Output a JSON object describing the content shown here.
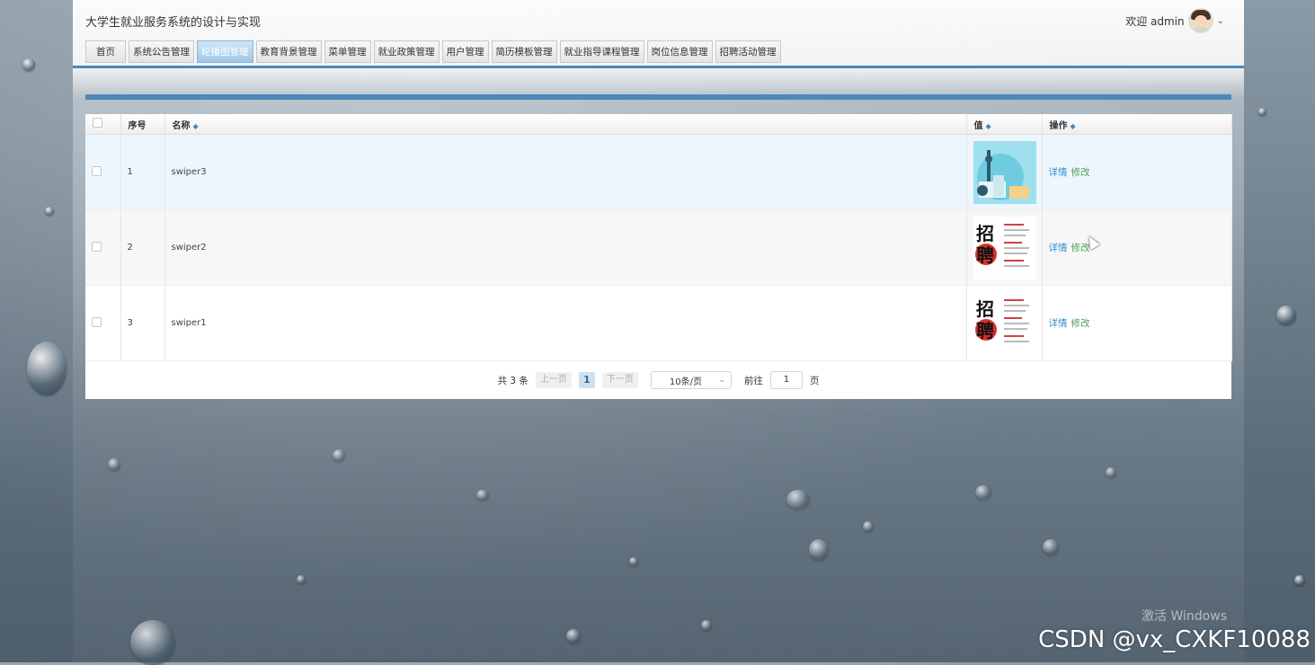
{
  "app": {
    "title": "大学生就业服务系统的设计与实现"
  },
  "user": {
    "greeting": "欢迎 admin",
    "chevron": "⌄"
  },
  "nav": {
    "tabs": [
      {
        "label": "首页",
        "active": false
      },
      {
        "label": "系统公告管理",
        "active": false
      },
      {
        "label": "轮播图管理",
        "active": true
      },
      {
        "label": "教育背景管理",
        "active": false
      },
      {
        "label": "菜单管理",
        "active": false
      },
      {
        "label": "就业政策管理",
        "active": false
      },
      {
        "label": "用户管理",
        "active": false
      },
      {
        "label": "简历模板管理",
        "active": false
      },
      {
        "label": "就业指导课程管理",
        "active": false
      },
      {
        "label": "岗位信息管理",
        "active": false
      },
      {
        "label": "招聘活动管理",
        "active": false
      }
    ]
  },
  "table": {
    "headers": {
      "index": "序号",
      "name": "名称",
      "value": "值",
      "actions": "操作"
    },
    "sort_icon": "◆",
    "rows": [
      {
        "index": "1",
        "name": "swiper3",
        "image": "city-illustration"
      },
      {
        "index": "2",
        "name": "swiper2",
        "image": "recruit-poster"
      },
      {
        "index": "3",
        "name": "swiper1",
        "image": "recruit-poster"
      }
    ],
    "action_detail": "详情",
    "action_edit": "修改",
    "poster_char1": "招",
    "poster_char2": "聘"
  },
  "pager": {
    "total": "共 3 条",
    "prev": "上一页",
    "current": "1",
    "next": "下一页",
    "page_size": "10条/页",
    "goto_label": "前往",
    "goto_value": "1",
    "page_unit": "页"
  },
  "overlay": {
    "activate": "激活 Windows",
    "watermark": "CSDN @vx_CXKF10088"
  },
  "colors": {
    "accent": "#4f87b8",
    "link": "#2f8ed0",
    "edit": "#4aa05a"
  }
}
